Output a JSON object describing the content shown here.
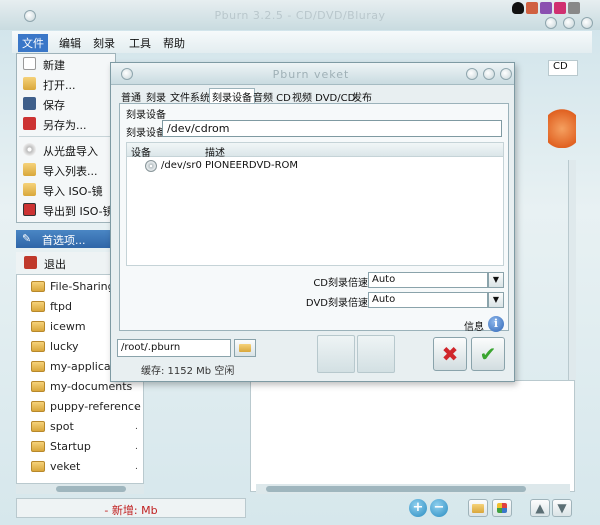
{
  "main_window": {
    "title": "Pburn 3.2.5 - CD/DVD/Bluray",
    "menus": [
      "文件",
      "编辑",
      "刻录",
      "工具",
      "帮助"
    ],
    "file_menu": [
      "新建",
      "打开...",
      "保存",
      "另存为...",
      "从光盘导入",
      "导入列表...",
      "导入 ISO-镜",
      "导出到 ISO-镜"
    ],
    "left_toolbar_label": "首选项...",
    "quit_label": "退出",
    "tree_items": [
      "File-Sharing",
      "ftpd",
      "icewm",
      "lucky",
      "my-applicatio",
      "my-documents",
      "puppy-reference",
      "spot",
      "Startup",
      "veket"
    ],
    "tree_mark": ".",
    "new_address": "- 新增:  Mb",
    "right_label": "CD"
  },
  "dialog": {
    "title": "Pburn    veket",
    "tabs": [
      "普通",
      "刻录",
      "文件系统",
      "刻录设备",
      "音频 CD",
      "视频 DVD/CD",
      "发布"
    ],
    "active_tab_index": 3,
    "group_title": "刻录设备",
    "device_label": "刻录设备:",
    "device_value": "/dev/cdrom",
    "list_headers": [
      "设备",
      "描述"
    ],
    "devices": [
      {
        "device": "/dev/sr0",
        "description": "PIONEERDVD-ROM"
      }
    ],
    "cd_speed_label": "CD刻录倍速",
    "cd_speed_value": "Auto",
    "dvd_speed_label": "DVD刻录倍速",
    "dvd_speed_value": "Auto",
    "info_label": "信息",
    "path_value": "/root/.pburn",
    "cache_text": "缓存: 1152 Mb 空闲"
  },
  "colors": {
    "accent": "#3a77c8",
    "cancel": "#d0262b",
    "ok": "#3aa530"
  }
}
